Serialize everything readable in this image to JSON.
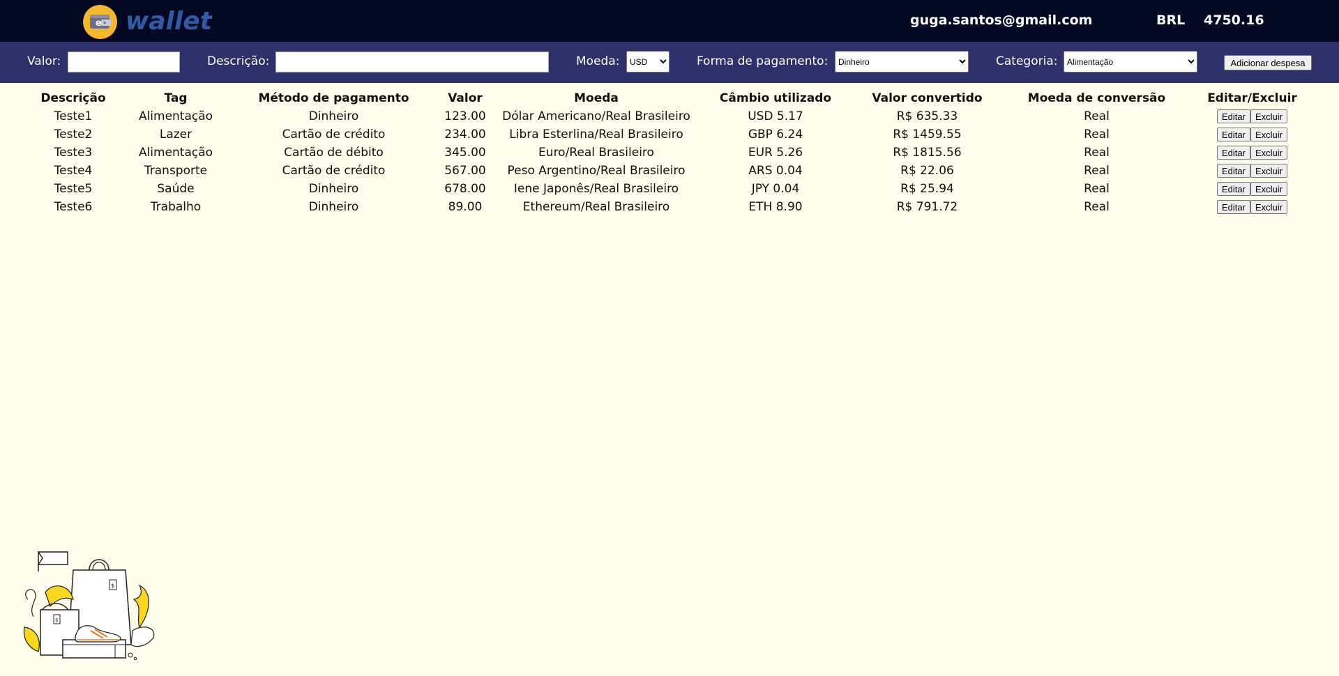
{
  "header": {
    "logo_text": "wallet",
    "logo_badge": "e",
    "email": "guga.santos@gmail.com",
    "currency": "BRL",
    "total": "4750.16"
  },
  "form": {
    "valor_label": "Valor:",
    "valor_value": "",
    "descricao_label": "Descrição:",
    "descricao_value": "",
    "moeda_label": "Moeda:",
    "moeda_selected": "USD",
    "pagamento_label": "Forma de pagamento:",
    "pagamento_selected": "Dinheiro",
    "categoria_label": "Categoria:",
    "categoria_selected": "Alimentação",
    "add_button": "Adicionar despesa"
  },
  "table": {
    "headers": [
      "Descrição",
      "Tag",
      "Método de pagamento",
      "Valor",
      "Moeda",
      "Câmbio utilizado",
      "Valor convertido",
      "Moeda de conversão",
      "Editar/Excluir"
    ],
    "edit_label": "Editar",
    "delete_label": "Excluir",
    "rows": [
      [
        "Teste1",
        "Alimentação",
        "Dinheiro",
        "123.00",
        "Dólar Americano/Real Brasileiro",
        "USD 5.17",
        "R$ 635.33",
        "Real"
      ],
      [
        "Teste2",
        "Lazer",
        "Cartão de crédito",
        "234.00",
        "Libra Esterlina/Real Brasileiro",
        "GBP 6.24",
        "R$ 1459.55",
        "Real"
      ],
      [
        "Teste3",
        "Alimentação",
        "Cartão de débito",
        "345.00",
        "Euro/Real Brasileiro",
        "EUR 5.26",
        "R$ 1815.56",
        "Real"
      ],
      [
        "Teste4",
        "Transporte",
        "Cartão de crédito",
        "567.00",
        "Peso Argentino/Real Brasileiro",
        "ARS 0.04",
        "R$ 22.06",
        "Real"
      ],
      [
        "Teste5",
        "Saúde",
        "Dinheiro",
        "678.00",
        "Iene Japonês/Real Brasileiro",
        "JPY 0.04",
        "R$ 25.94",
        "Real"
      ],
      [
        "Teste6",
        "Trabalho",
        "Dinheiro",
        "89.00",
        "Ethereum/Real Brasileiro",
        "ETH 8.90",
        "R$ 791.72",
        "Real"
      ]
    ]
  },
  "colors": {
    "topbar": "#030822",
    "formbar": "#2d3069",
    "background": "#fffdeb",
    "logo_badge": "#f6b72a",
    "logo_text": "#2f5ba4"
  }
}
